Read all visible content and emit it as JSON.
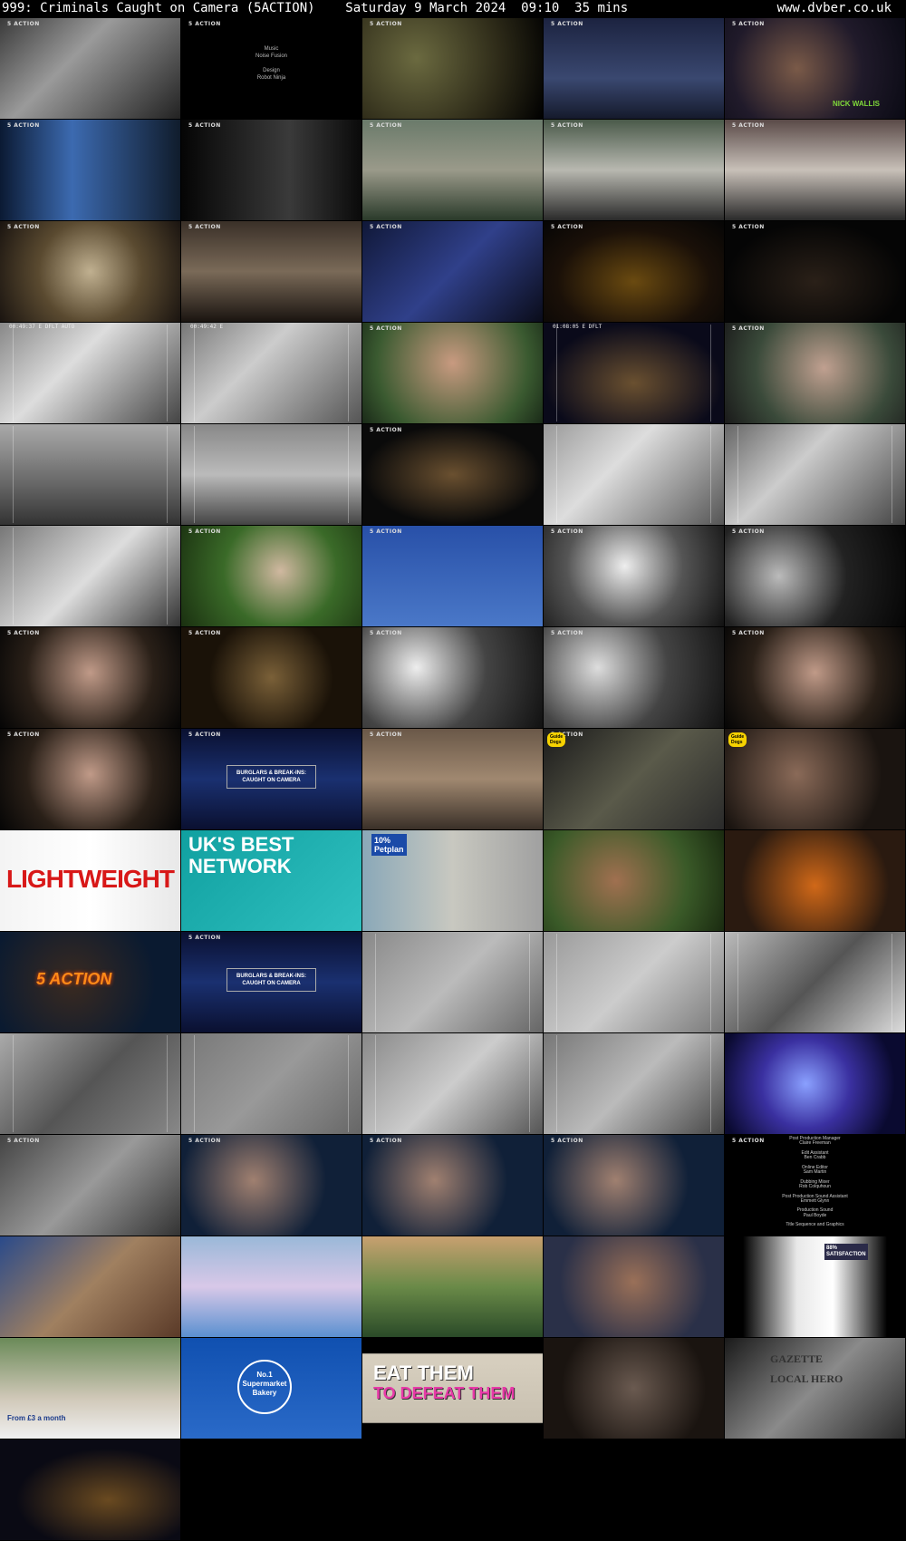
{
  "header": {
    "title": "999: Criminals Caught on Camera (5ACTION)    Saturday 9 March 2024  09:10  35 mins",
    "site": "www.dvber.co.uk"
  },
  "channel_logo": "5 ACTION",
  "thumbs": [
    {
      "bg": "linear-gradient(135deg,#3a3a3a,#9a9a9a 40%,#222)",
      "logo": true
    },
    {
      "bg": "#000",
      "logo": true,
      "lines": [
        "Music",
        "Noise Fusion",
        "",
        "Design",
        "Robot Ninja"
      ],
      "cap_style": "credits"
    },
    {
      "bg": "radial-gradient(circle at 30% 40%,#6b6a40,#2d2a18 60%,#000)",
      "logo": true
    },
    {
      "bg": "linear-gradient(180deg,#1c2340,#3a4870 60%,#151a2c)",
      "logo": true
    },
    {
      "bg": "radial-gradient(circle at 40% 50%,#7a5a48,#201a2a 55%,#0a0a14)",
      "logo": true,
      "lines": [
        "NICK WALLIS"
      ],
      "cap_style": "name"
    },
    {
      "bg": "linear-gradient(90deg,#0b1a33,#3c6ab0 40%,#101c2c)",
      "logo": true
    },
    {
      "bg": "linear-gradient(90deg,#050505,#3a3a3a 60%,#0a0a0a)",
      "logo": true
    },
    {
      "bg": "linear-gradient(180deg,#6a7a6a,#9a9a8a 50%,#2a3a2a)",
      "logo": true
    },
    {
      "bg": "linear-gradient(180deg,#4a5a4a,#b8b8b0 50%,#2a2a2a)",
      "logo": true
    },
    {
      "bg": "linear-gradient(180deg,#5a4a48,#c8c0b8 50%,#2a2a2a)",
      "logo": true
    },
    {
      "bg": "radial-gradient(circle at 50% 50%,#c0b090,#5a4a30 50%,#1a1410)",
      "logo": true
    },
    {
      "bg": "linear-gradient(180deg,#3a3028,#7a6a58 50%,#1a1410)",
      "logo": true
    },
    {
      "bg": "linear-gradient(135deg,#101838,#30408a 50%,#0a0c1a)",
      "logo": true
    },
    {
      "bg": "radial-gradient(ellipse at 50% 60%,#6a4a10,#1a1008 60%,#050505)",
      "logo": true
    },
    {
      "bg": "radial-gradient(ellipse at 50% 60%,#2a2018,#050505 70%)",
      "logo": true
    },
    {
      "bg": "linear-gradient(135deg,#888,#ddd 40%,#444)",
      "hud": true,
      "hud_text": "00:49:37 E  DFLT  AUTO"
    },
    {
      "bg": "linear-gradient(135deg,#777,#ccc 40%,#555)",
      "hud": true,
      "hud_text": "00:49:42 E"
    },
    {
      "bg": "radial-gradient(circle at 50% 40%,#c89a80,#3a5a30 70%,#1a2a18)",
      "logo": true
    },
    {
      "bg": "radial-gradient(ellipse at 50% 60%,#6a5030,#0a0a1a 70%)",
      "hud": true,
      "hud_text": "01:08:05 E  DFLT"
    },
    {
      "bg": "radial-gradient(circle at 55% 45%,#c0a090,#3a4a3a 60%,#1a1a1a)",
      "logo": true
    },
    {
      "bg": "linear-gradient(180deg,#aaa,#666 60%,#333)",
      "hud": true,
      "hud_text": ""
    },
    {
      "bg": "linear-gradient(180deg,#888,#bbb 50%,#444)",
      "hud": true,
      "hud_text": ""
    },
    {
      "bg": "radial-gradient(ellipse at 50% 50%,#6a5030,#0a0a0a 70%)",
      "logo": true
    },
    {
      "bg": "linear-gradient(135deg,#999,#ddd 40%,#555)",
      "hud": true,
      "hud_text": ""
    },
    {
      "bg": "linear-gradient(135deg,#666,#ccc 40%,#444)",
      "hud": true,
      "hud_text": ""
    },
    {
      "bg": "linear-gradient(135deg,#777,#ddd 50%,#333)",
      "hud": true,
      "hud_text": ""
    },
    {
      "bg": "radial-gradient(circle at 55% 45%,#d0b8a0,#3a6a28 50%,#1a3010)",
      "logo": true
    },
    {
      "bg": "linear-gradient(180deg,#2850a8,#4a78c8)",
      "logo": true
    },
    {
      "bg": "radial-gradient(circle at 45% 40%,#eee,#555 50%,#111)",
      "logo": true
    },
    {
      "bg": "radial-gradient(circle at 30% 50%,#bbb,#222 50%,#050505)",
      "logo": true
    },
    {
      "bg": "radial-gradient(circle at 50% 45%,#c09a88,#2a2018 60%,#050505)",
      "logo": true
    },
    {
      "bg": "radial-gradient(circle at 50% 50%,#7a6038,#1a1208 60%)",
      "logo": true
    },
    {
      "bg": "radial-gradient(circle at 30% 40%,#eee,#444 50%,#111)",
      "logo": true
    },
    {
      "bg": "radial-gradient(circle at 30% 40%,#ddd,#444 50%,#111)",
      "logo": true
    },
    {
      "bg": "radial-gradient(circle at 50% 45%,#c09a88,#2a2018 60%,#050505)",
      "logo": true
    },
    {
      "bg": "radial-gradient(circle at 50% 45%,#c09a88,#2a2018 60%,#050505)",
      "logo": true
    },
    {
      "bg": "linear-gradient(180deg,#0a1030,#1a3070 50%,#0a1030)",
      "logo": true,
      "lines": [
        "BURGLARS & BREAK-INS:",
        "CAUGHT ON CAMERA"
      ],
      "cap_style": "promo"
    },
    {
      "bg": "linear-gradient(180deg,#6a5848,#a08870 50%,#3a3028)",
      "logo": true
    },
    {
      "bg": "linear-gradient(135deg,#1a1a1a,#5a5a4a 50%,#2a2a2a)",
      "logo": true,
      "lines": [
        "Guide",
        "Dogs"
      ],
      "cap_style": "brand"
    },
    {
      "bg": "radial-gradient(circle at 40% 45%,#8a6a58,#1a1410 70%)",
      "logo": false,
      "lines": [
        "Guide",
        "Dogs"
      ],
      "cap_style": "brand"
    },
    {
      "bg": "linear-gradient(90deg,#f4f4f4,#fff 50%,#e8e8e8)",
      "logo": false,
      "lines": [
        "LIGHTWEIGHT"
      ],
      "cap_style": "big-red"
    },
    {
      "bg": "linear-gradient(135deg,#10a0a0,#30c0c0)",
      "logo": false,
      "lines": [
        "UK'S BEST",
        "NETWORK"
      ],
      "cap_style": "big-white"
    },
    {
      "bg": "linear-gradient(90deg,#8aa8b8,#c8c8c0 50%,#a0a0a0)",
      "logo": false,
      "lines": [
        "10%",
        "Petplan"
      ],
      "cap_style": "petplan"
    },
    {
      "bg": "radial-gradient(circle at 40% 50%,#a07050,#3a5a28 60%,#1a2a10)",
      "logo": false
    },
    {
      "bg": "radial-gradient(circle at 50% 55%,#d06818,#2a1a10 70%)",
      "logo": false
    },
    {
      "bg": "radial-gradient(circle at 40% 50%,#3a2a20,#0a1a30 70%)",
      "logo": false,
      "lines": [
        "5 ACTION"
      ],
      "cap_style": "fire"
    },
    {
      "bg": "linear-gradient(180deg,#0a1030,#1a3070 50%,#0a1030)",
      "logo": true,
      "lines": [
        "BURGLARS & BREAK-INS:",
        "CAUGHT ON CAMERA"
      ],
      "cap_style": "promo"
    },
    {
      "bg": "linear-gradient(135deg,#888,#bbb 50%,#666)",
      "hud": true,
      "hud_text": ""
    },
    {
      "bg": "linear-gradient(135deg,#999,#ccc 50%,#777)",
      "hud": true,
      "hud_text": ""
    },
    {
      "bg": "linear-gradient(135deg,#bbb,#555 50%,#ddd)",
      "hud": true,
      "hud_text": ""
    },
    {
      "bg": "linear-gradient(135deg,#aaa,#555 50%,#888)",
      "hud": true,
      "hud_text": ""
    },
    {
      "bg": "linear-gradient(135deg,#777,#999 50%,#666)",
      "hud": true,
      "hud_text": ""
    },
    {
      "bg": "linear-gradient(135deg,#888,#ccc 50%,#555)",
      "hud": true,
      "hud_text": ""
    },
    {
      "bg": "linear-gradient(135deg,#777,#bbb 50%,#444)",
      "hud": true,
      "hud_text": ""
    },
    {
      "bg": "radial-gradient(circle at 45% 50%,#8aa0ff,#3a30a0 40%,#0a0a30 80%)",
      "logo": false
    },
    {
      "bg": "linear-gradient(135deg,#444,#999 50%,#333)",
      "logo": true
    },
    {
      "bg": "radial-gradient(circle at 40% 45%,#a08070,#102038 60%)",
      "logo": true
    },
    {
      "bg": "radial-gradient(circle at 40% 45%,#a08070,#102038 60%)",
      "logo": true
    },
    {
      "bg": "radial-gradient(circle at 40% 45%,#a08070,#102038 60%)",
      "logo": true
    },
    {
      "bg": "#000",
      "logo": true,
      "lines": [
        "Post Production Manager",
        "Claire Freeman",
        "",
        "Edit Assistant",
        "Ben Crabb",
        "",
        "Online Editor",
        "Sam Martin",
        "",
        "Dubbing Mixer",
        "Rob Colquhoun",
        "",
        "Post Production Sound Assistant",
        "Emmett Glynn",
        "",
        "Production Sound",
        "Paul Boyde",
        "",
        "Title Sequence and Graphics"
      ],
      "cap_style": "credits-long"
    },
    {
      "bg": "linear-gradient(135deg,#2a4a8a,#a08060 50%,#5a3a28)",
      "logo": false
    },
    {
      "bg": "linear-gradient(180deg,#9ab8d8,#d8c8e8 50%,#5a90d0)",
      "logo": false
    },
    {
      "bg": "linear-gradient(180deg,#c8a070,#6a8a48 50%,#2a4a28)",
      "logo": false
    },
    {
      "bg": "radial-gradient(circle at 50% 45%,#9a7058,#2a3048 70%)",
      "logo": false
    },
    {
      "bg": "linear-gradient(90deg,#000 10%,#e8e8e8 40%,#fff 60%,#000 90%)",
      "logo": false,
      "lines": [
        "88%",
        "SATISFACTION"
      ],
      "cap_style": "satisfaction"
    },
    {
      "bg": "linear-gradient(180deg,#6a8a58,#d0c8b8 60%,#f0f0f0)",
      "logo": false,
      "lines": [
        "From £3 a month"
      ],
      "cap_style": "legal"
    },
    {
      "bg": "linear-gradient(180deg,#1050b0,#2a6ac8)",
      "logo": false,
      "lines": [
        "No.1",
        "Supermarket",
        "Bakery"
      ],
      "cap_style": "bakery"
    },
    {
      "bg": "linear-gradient(180deg,#000 15%,#d8d0c0 16%,#c8c0b0 84%,#000 85%)",
      "logo": false,
      "lines": [
        "EAT THEM",
        "TO DEFEAT THEM"
      ],
      "cap_style": "eat"
    },
    {
      "bg": "radial-gradient(circle at 50% 50%,#6a5a50,#1a1410 70%)",
      "logo": false
    },
    {
      "bg": "linear-gradient(135deg,#1a1a1a,#8a8a8a 50%,#2a2a2a)",
      "logo": false,
      "lines": [
        "GAZETTE",
        "LOCAL HERO"
      ],
      "cap_style": "gazette"
    },
    {
      "bg": "radial-gradient(ellipse at 60% 60%,#6a4a20,#0a0a14 60%)",
      "logo": false
    }
  ]
}
